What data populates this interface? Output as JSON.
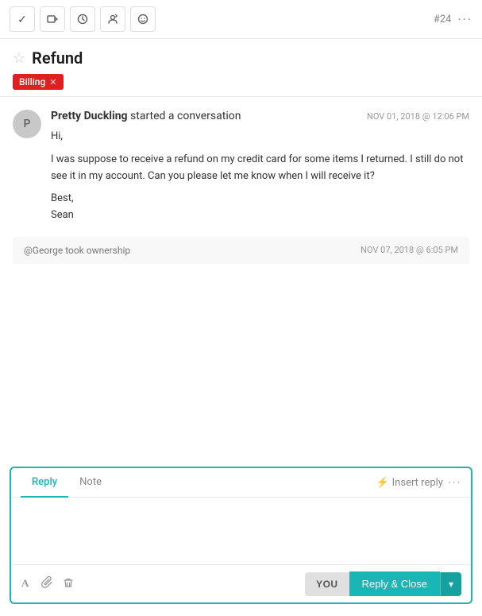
{
  "toolbar": {
    "ticket_num": "#24",
    "buttons": [
      {
        "name": "check-icon",
        "symbol": "✓"
      },
      {
        "name": "label-icon",
        "symbol": "⬜"
      },
      {
        "name": "clock-icon",
        "symbol": "🕐"
      },
      {
        "name": "filter-icon",
        "symbol": "⬇"
      },
      {
        "name": "emoji-icon",
        "symbol": "☺"
      }
    ],
    "more_dots": "···"
  },
  "ticket": {
    "star_label": "☆",
    "title": "Refund",
    "tag": "Billing",
    "tag_close": "✕"
  },
  "message": {
    "avatar": "P",
    "sender": "Pretty Duckling",
    "action": "started a conversation",
    "time": "NOV 01, 2018 @ 12:06 PM",
    "body_lines": [
      "Hi,",
      "I was suppose to receive a refund on my credit card for some items I returned. I still do not see it in my account. Can you please let me know when I will receive it?",
      "Best,",
      "Sean"
    ]
  },
  "activity": {
    "text": "@George took ownership",
    "time": "NOV 07, 2018 @ 6:05 PM"
  },
  "composer": {
    "tab_reply": "Reply",
    "tab_note": "Note",
    "insert_reply": "Insert reply",
    "dots": "···",
    "placeholder": "",
    "footer": {
      "you_label": "YOU",
      "reply_close_label": "Reply & Close",
      "dropdown_arrow": "▾"
    }
  }
}
